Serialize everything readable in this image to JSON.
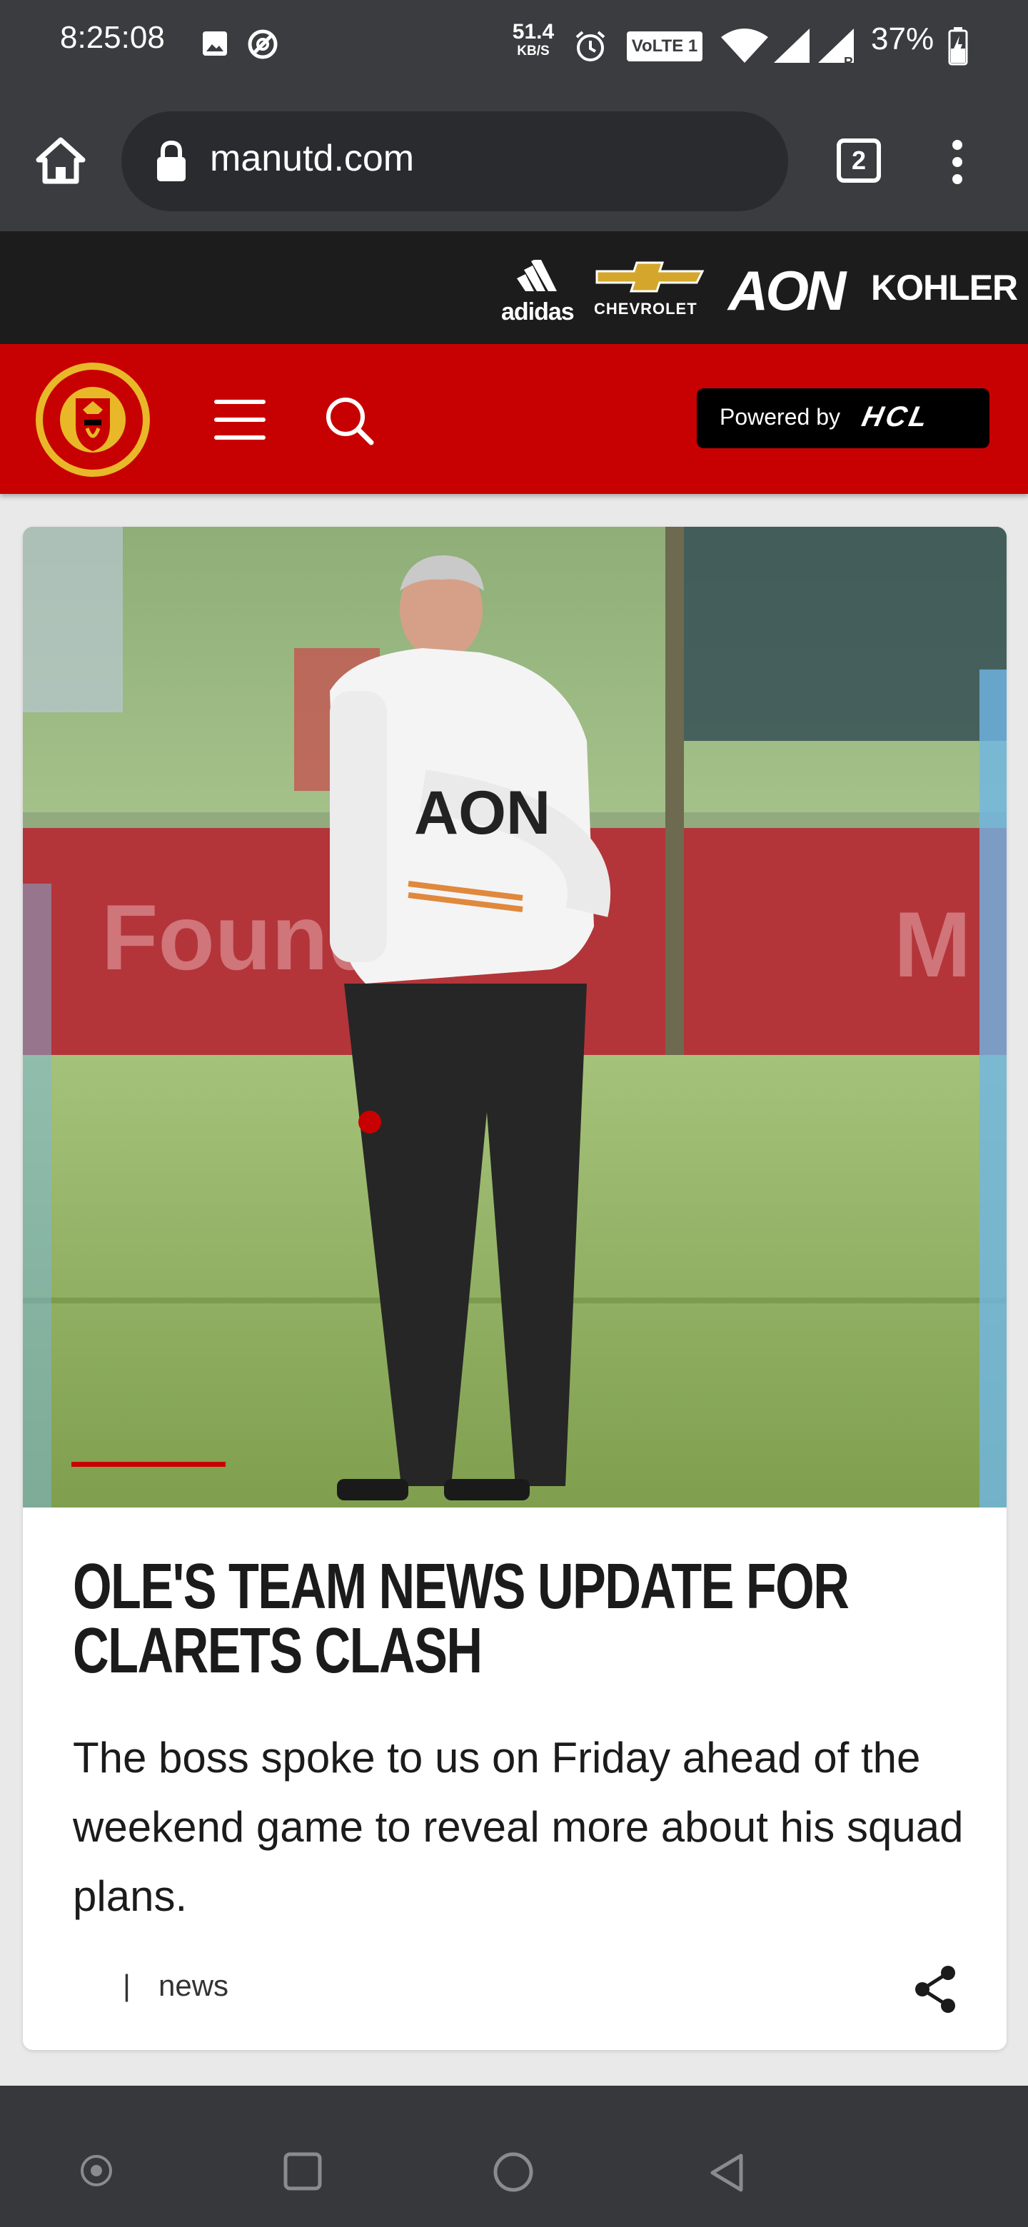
{
  "status_bar": {
    "time": "8:25:08",
    "net_speed_value": "51.4",
    "net_speed_unit": "KB/S",
    "volte_label": "VoLTE 1",
    "battery_percent": "37%",
    "icons": [
      "image-icon",
      "do-not-disturb-icon",
      "alarm-icon",
      "wifi-icon",
      "signal-icon",
      "signal-roaming-icon",
      "battery-charging-icon"
    ]
  },
  "browser": {
    "url": "manutd.com",
    "tab_count": "2",
    "icons": [
      "home-icon",
      "lock-icon",
      "more-vert-icon"
    ]
  },
  "sponsors": [
    "adidas",
    "CHEVROLET",
    "AON",
    "KOHLER"
  ],
  "header": {
    "powered_by_label": "Powered by",
    "powered_by_brand": "HCL",
    "icons": [
      "club-crest-logo",
      "menu-icon",
      "search-icon"
    ],
    "accent_color": "#c70101"
  },
  "article": {
    "headline": "OLE'S TEAM NEWS UPDATE FOR CLARETS CLASH",
    "summary": "The boss spoke to us on Friday ahead of the weekend game to reveal more about his squad plans.",
    "separator": "|",
    "category": "news",
    "icons": [
      "share-icon"
    ]
  },
  "nav_bar": {
    "icons": [
      "dot-icon",
      "recents-icon",
      "home-circle-icon",
      "back-icon"
    ]
  }
}
